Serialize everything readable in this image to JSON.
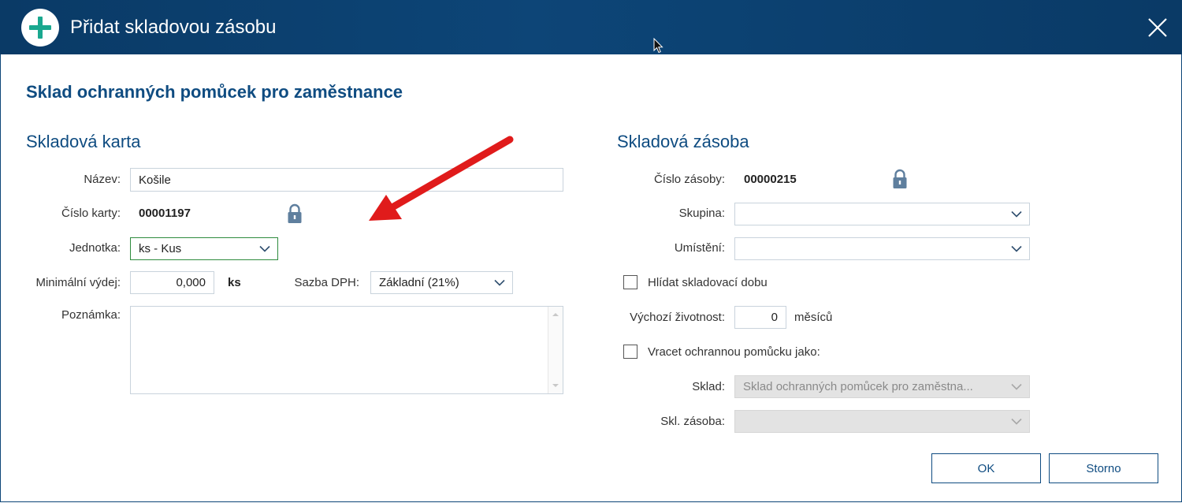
{
  "window": {
    "title": "Přidat skladovou zásobu"
  },
  "heading": "Sklad ochranných pomůcek pro zaměstnance",
  "left": {
    "section_title": "Skladová karta",
    "nazev_label": "Název:",
    "nazev_value": "Košile",
    "cislo_karty_label": "Číslo karty:",
    "cislo_karty_value": "00001197",
    "jednotka_label": "Jednotka:",
    "jednotka_value": "ks - Kus",
    "min_vydej_label": "Minimální výdej:",
    "min_vydej_value": "0,000",
    "min_vydej_unit": "ks",
    "sazba_label": "Sazba DPH:",
    "sazba_value": "Základní (21%)",
    "poznamka_label": "Poznámka:",
    "poznamka_value": ""
  },
  "right": {
    "section_title": "Skladová zásoba",
    "cislo_zasoby_label": "Číslo zásoby:",
    "cislo_zasoby_value": "00000215",
    "skupina_label": "Skupina:",
    "skupina_value": "",
    "umisteni_label": "Umístění:",
    "umisteni_value": "",
    "hlidat_label": "Hlídat skladovací dobu",
    "hlidat_checked": false,
    "zivotnost_label": "Výchozí životnost:",
    "zivotnost_value": "0",
    "zivotnost_unit": "měsíců",
    "vracet_label": "Vracet ochrannou pomůcku jako:",
    "vracet_checked": false,
    "sklad_label": "Sklad:",
    "sklad_value": "Sklad ochranných pomůcek pro zaměstna...",
    "skl_zasoba_label": "Skl. zásoba:",
    "skl_zasoba_value": ""
  },
  "buttons": {
    "ok": "OK",
    "storno": "Storno"
  },
  "colors": {
    "titlebar": "#0d4577",
    "heading": "#0f4c81",
    "accent_plus": "#1aa88f",
    "arrow": "#e01b1b",
    "focus_border": "#2e8b3e"
  },
  "icons": [
    "add-icon",
    "close-icon",
    "lock-icon",
    "chevron-down-icon",
    "mouse-cursor-icon",
    "red-arrow"
  ]
}
